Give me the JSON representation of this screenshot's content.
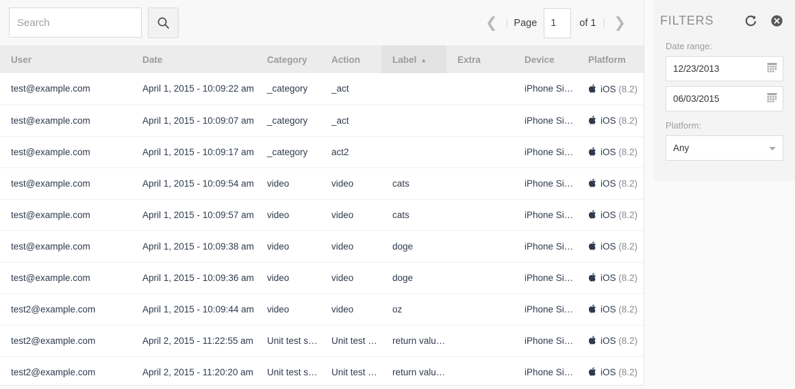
{
  "toolbar": {
    "search": {
      "placeholder": "Search",
      "value": "",
      "icon": "search-icon"
    },
    "search_button_icon": "search-icon",
    "pager": {
      "prev_icon": "❮",
      "next_icon": "❯",
      "page_label": "Page",
      "page_value": "1",
      "of_label": "of 1",
      "separator": "|"
    }
  },
  "table": {
    "columns": [
      {
        "key": "user",
        "label": "User",
        "sorted": false
      },
      {
        "key": "date",
        "label": "Date",
        "sorted": false
      },
      {
        "key": "category",
        "label": "Category",
        "sorted": false
      },
      {
        "key": "action",
        "label": "Action",
        "sorted": false
      },
      {
        "key": "label",
        "label": "Label",
        "sorted": true,
        "sort_dir": "asc",
        "sort_caret": "▲"
      },
      {
        "key": "extra",
        "label": "Extra",
        "sorted": false
      },
      {
        "key": "device",
        "label": "Device",
        "sorted": false
      },
      {
        "key": "platform",
        "label": "Platform",
        "sorted": false
      }
    ],
    "rows": [
      {
        "user": "test@example.com",
        "date": "April 1, 2015 - 10:09:22 am",
        "category": "_category",
        "action": "_act",
        "label": "",
        "extra": "",
        "device": "iPhone Si…",
        "platform_icon": "apple-icon",
        "platform": "iOS",
        "platform_version": "(8.2)"
      },
      {
        "user": "test@example.com",
        "date": "April 1, 2015 - 10:09:07 am",
        "category": "_category",
        "action": "_act",
        "label": "",
        "extra": "",
        "device": "iPhone Si…",
        "platform_icon": "apple-icon",
        "platform": "iOS",
        "platform_version": "(8.2)"
      },
      {
        "user": "test@example.com",
        "date": "April 1, 2015 - 10:09:17 am",
        "category": "_category",
        "action": "act2",
        "label": "",
        "extra": "",
        "device": "iPhone Si…",
        "platform_icon": "apple-icon",
        "platform": "iOS",
        "platform_version": "(8.2)"
      },
      {
        "user": "test@example.com",
        "date": "April 1, 2015 - 10:09:54 am",
        "category": "video",
        "action": "video",
        "label": "cats",
        "extra": "",
        "device": "iPhone Si…",
        "platform_icon": "apple-icon",
        "platform": "iOS",
        "platform_version": "(8.2)"
      },
      {
        "user": "test@example.com",
        "date": "April 1, 2015 - 10:09:57 am",
        "category": "video",
        "action": "video",
        "label": "cats",
        "extra": "",
        "device": "iPhone Si…",
        "platform_icon": "apple-icon",
        "platform": "iOS",
        "platform_version": "(8.2)"
      },
      {
        "user": "test@example.com",
        "date": "April 1, 2015 - 10:09:38 am",
        "category": "video",
        "action": "video",
        "label": "doge",
        "extra": "",
        "device": "iPhone Si…",
        "platform_icon": "apple-icon",
        "platform": "iOS",
        "platform_version": "(8.2)"
      },
      {
        "user": "test@example.com",
        "date": "April 1, 2015 - 10:09:36 am",
        "category": "video",
        "action": "video",
        "label": "doge",
        "extra": "",
        "device": "iPhone Si…",
        "platform_icon": "apple-icon",
        "platform": "iOS",
        "platform_version": "(8.2)"
      },
      {
        "user": "test2@example.com",
        "date": "April 1, 2015 - 10:09:44 am",
        "category": "video",
        "action": "video",
        "label": "oz",
        "extra": "",
        "device": "iPhone Si…",
        "platform_icon": "apple-icon",
        "platform": "iOS",
        "platform_version": "(8.2)"
      },
      {
        "user": "test2@example.com",
        "date": "April 2, 2015 - 11:22:55 am",
        "category": "Unit test s…",
        "action": "Unit test s…",
        "label": "return valu…",
        "extra": "",
        "device": "iPhone Si…",
        "platform_icon": "apple-icon",
        "platform": "iOS",
        "platform_version": "(8.2)"
      },
      {
        "user": "test2@example.com",
        "date": "April 2, 2015 - 11:20:20 am",
        "category": "Unit test s…",
        "action": "Unit test s…",
        "label": "return valu…",
        "extra": "",
        "device": "iPhone Si…",
        "platform_icon": "apple-icon",
        "platform": "iOS",
        "platform_version": "(8.2)"
      }
    ]
  },
  "filters": {
    "title": "FILTERS",
    "refresh_icon": "refresh-icon",
    "close_icon": "close-circle-icon",
    "date_range_label": "Date range:",
    "date_from": "12/23/2013",
    "date_to": "06/03/2015",
    "calendar_icon": "calendar-icon",
    "platform_label": "Platform:",
    "platform_value": "Any"
  },
  "colors": {
    "panel_bg": "#ffffff",
    "page_bg": "#fafafa",
    "header_row": "#ececec",
    "sorted_header": "#e3e3e3",
    "text_primary": "#2e3a4d",
    "text_muted": "#a4a4a4",
    "filters_bg": "#f4f4f4"
  }
}
